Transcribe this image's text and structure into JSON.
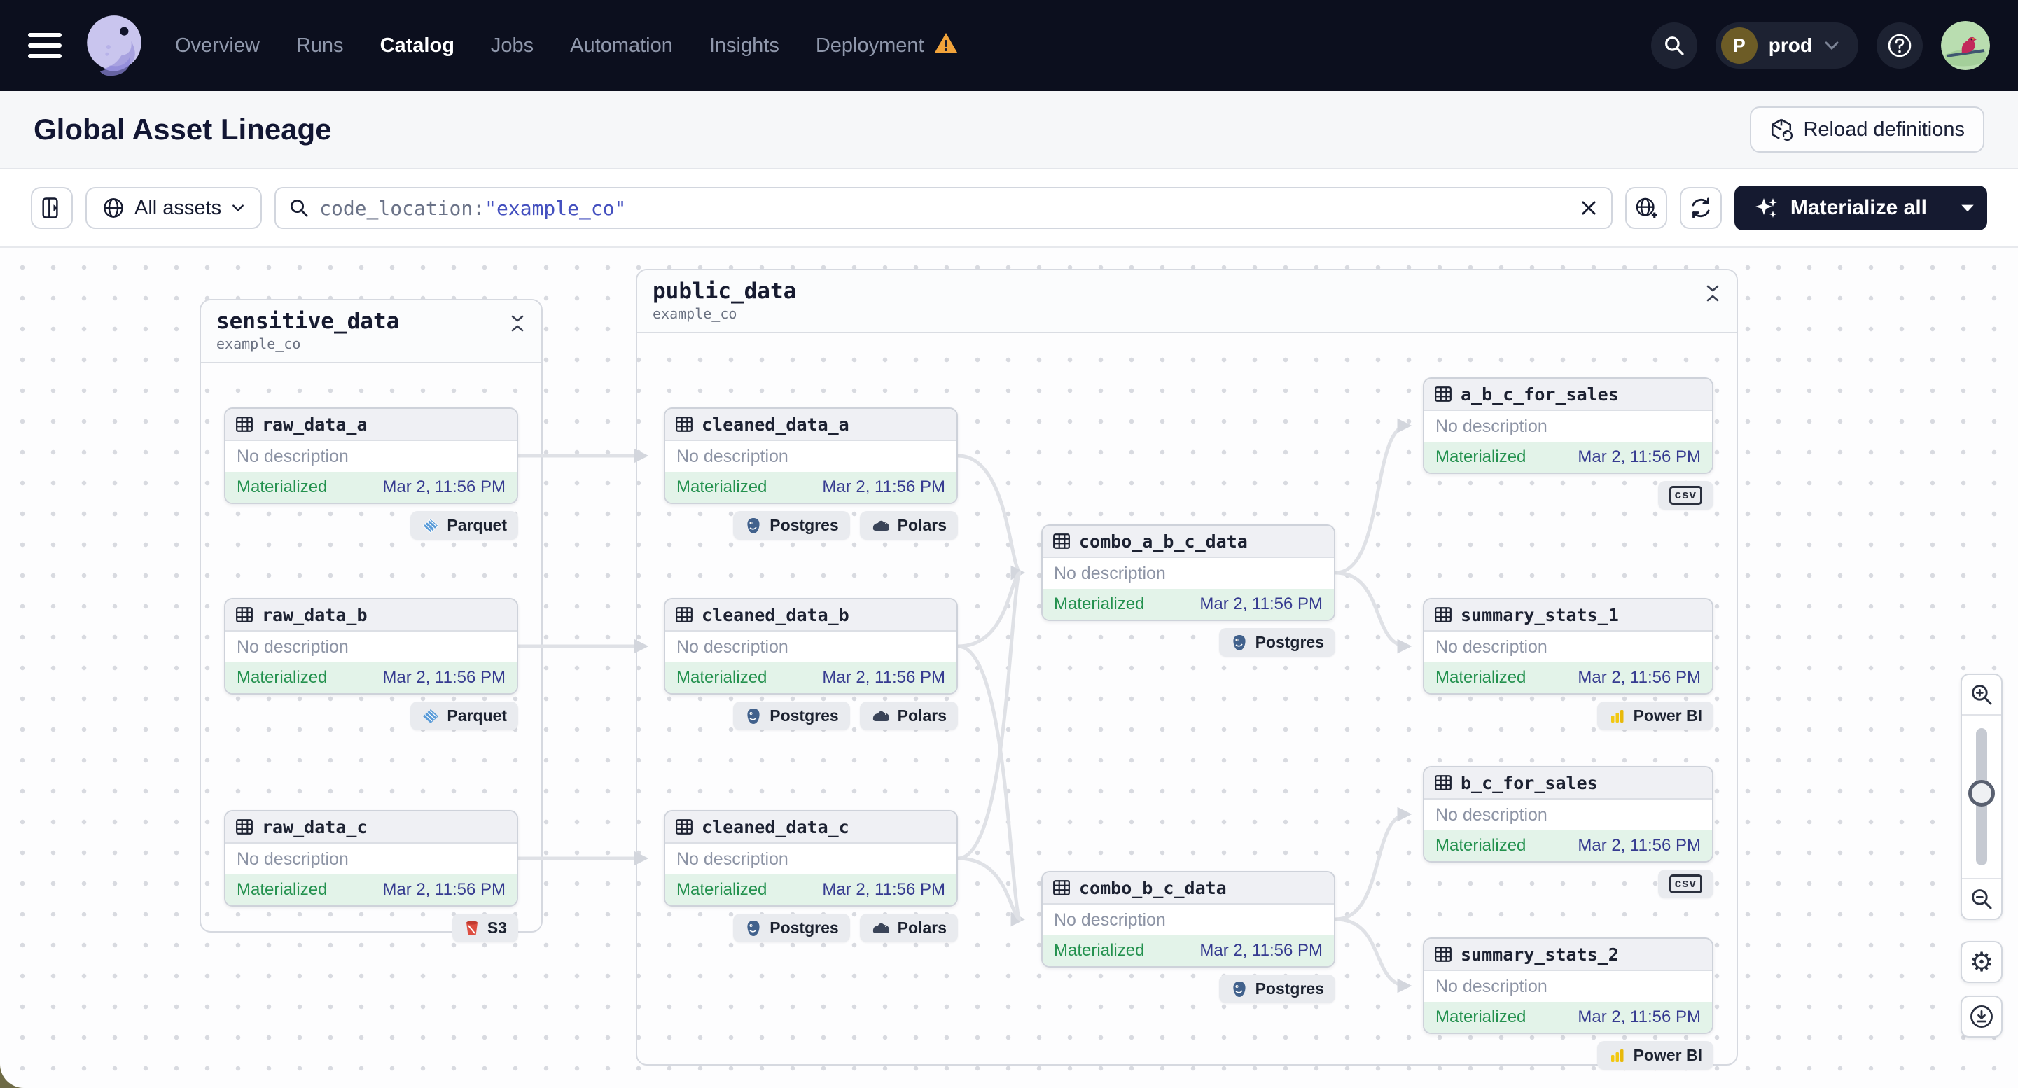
{
  "nav": {
    "items": [
      "Overview",
      "Runs",
      "Catalog",
      "Jobs",
      "Automation",
      "Insights",
      "Deployment"
    ],
    "active_item": "Catalog",
    "environment": {
      "initial": "P",
      "name": "prod"
    }
  },
  "header": {
    "title": "Global Asset Lineage",
    "reload_button": "Reload definitions"
  },
  "toolbar": {
    "filter_label": "All assets",
    "search_token": "code_location:",
    "search_value": "\"example_co\"",
    "materialize_label": "Materialize all"
  },
  "graph": {
    "groups": [
      {
        "name": "sensitive_data",
        "location": "example_co"
      },
      {
        "name": "public_data",
        "location": "example_co"
      }
    ],
    "shared": {
      "description": "No description",
      "status": "Materialized",
      "timestamp": "Mar 2, 11:56 PM"
    },
    "nodes": [
      {
        "name": "raw_data_a",
        "badges": [
          {
            "icon": "parquet-icon",
            "label": "Parquet"
          }
        ]
      },
      {
        "name": "raw_data_b",
        "badges": [
          {
            "icon": "parquet-icon",
            "label": "Parquet"
          }
        ]
      },
      {
        "name": "raw_data_c",
        "badges": [
          {
            "icon": "s3-icon",
            "label": "S3"
          }
        ]
      },
      {
        "name": "cleaned_data_a",
        "badges": [
          {
            "icon": "postgres-icon",
            "label": "Postgres"
          },
          {
            "icon": "polars-icon",
            "label": "Polars"
          }
        ]
      },
      {
        "name": "cleaned_data_b",
        "badges": [
          {
            "icon": "postgres-icon",
            "label": "Postgres"
          },
          {
            "icon": "polars-icon",
            "label": "Polars"
          }
        ]
      },
      {
        "name": "cleaned_data_c",
        "badges": [
          {
            "icon": "postgres-icon",
            "label": "Postgres"
          },
          {
            "icon": "polars-icon",
            "label": "Polars"
          }
        ]
      },
      {
        "name": "combo_a_b_c_data",
        "badges": [
          {
            "icon": "postgres-icon",
            "label": "Postgres"
          }
        ]
      },
      {
        "name": "combo_b_c_data",
        "badges": [
          {
            "icon": "postgres-icon",
            "label": "Postgres"
          }
        ]
      },
      {
        "name": "a_b_c_for_sales",
        "badges": [
          {
            "icon": "csv-icon",
            "label": "csv"
          }
        ]
      },
      {
        "name": "summary_stats_1",
        "badges": [
          {
            "icon": "powerbi-icon",
            "label": "Power BI"
          }
        ]
      },
      {
        "name": "b_c_for_sales",
        "badges": [
          {
            "icon": "csv-icon",
            "label": "csv"
          }
        ]
      },
      {
        "name": "summary_stats_2",
        "badges": [
          {
            "icon": "powerbi-icon",
            "label": "Power BI"
          }
        ]
      }
    ]
  },
  "colors": {
    "nav_bg": "#0c0f1e",
    "accent_dark": "#151a30",
    "materialized_green": "#23914e",
    "timestamp_indigo": "#363b90",
    "search_value_blue": "#4450bf",
    "warning_orange": "#f2a33a"
  }
}
